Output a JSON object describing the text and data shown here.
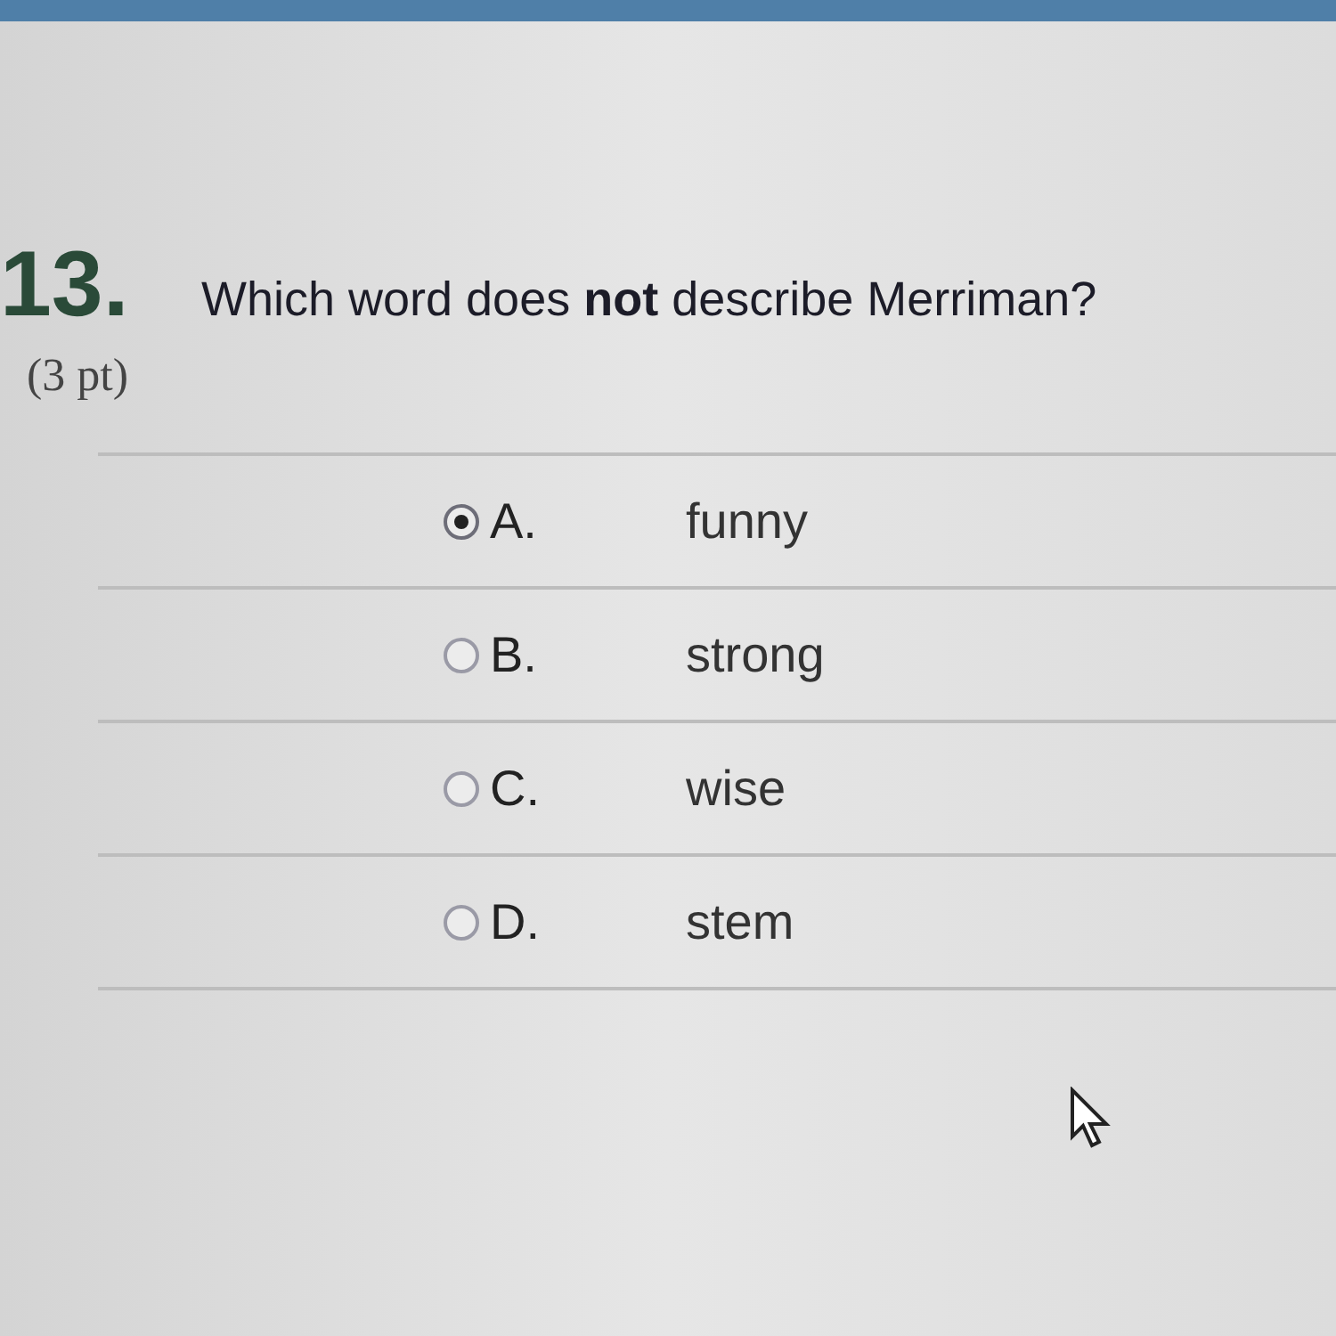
{
  "question": {
    "number": "13.",
    "text": "Which word does **not** describe Merriman?",
    "points": "(3 pt)"
  },
  "options": [
    {
      "letter": "A.",
      "text": "funny",
      "selected": true
    },
    {
      "letter": "B.",
      "text": "strong",
      "selected": false
    },
    {
      "letter": "C.",
      "text": "wise",
      "selected": false
    },
    {
      "letter": "D.",
      "text": "stem",
      "selected": false
    }
  ]
}
